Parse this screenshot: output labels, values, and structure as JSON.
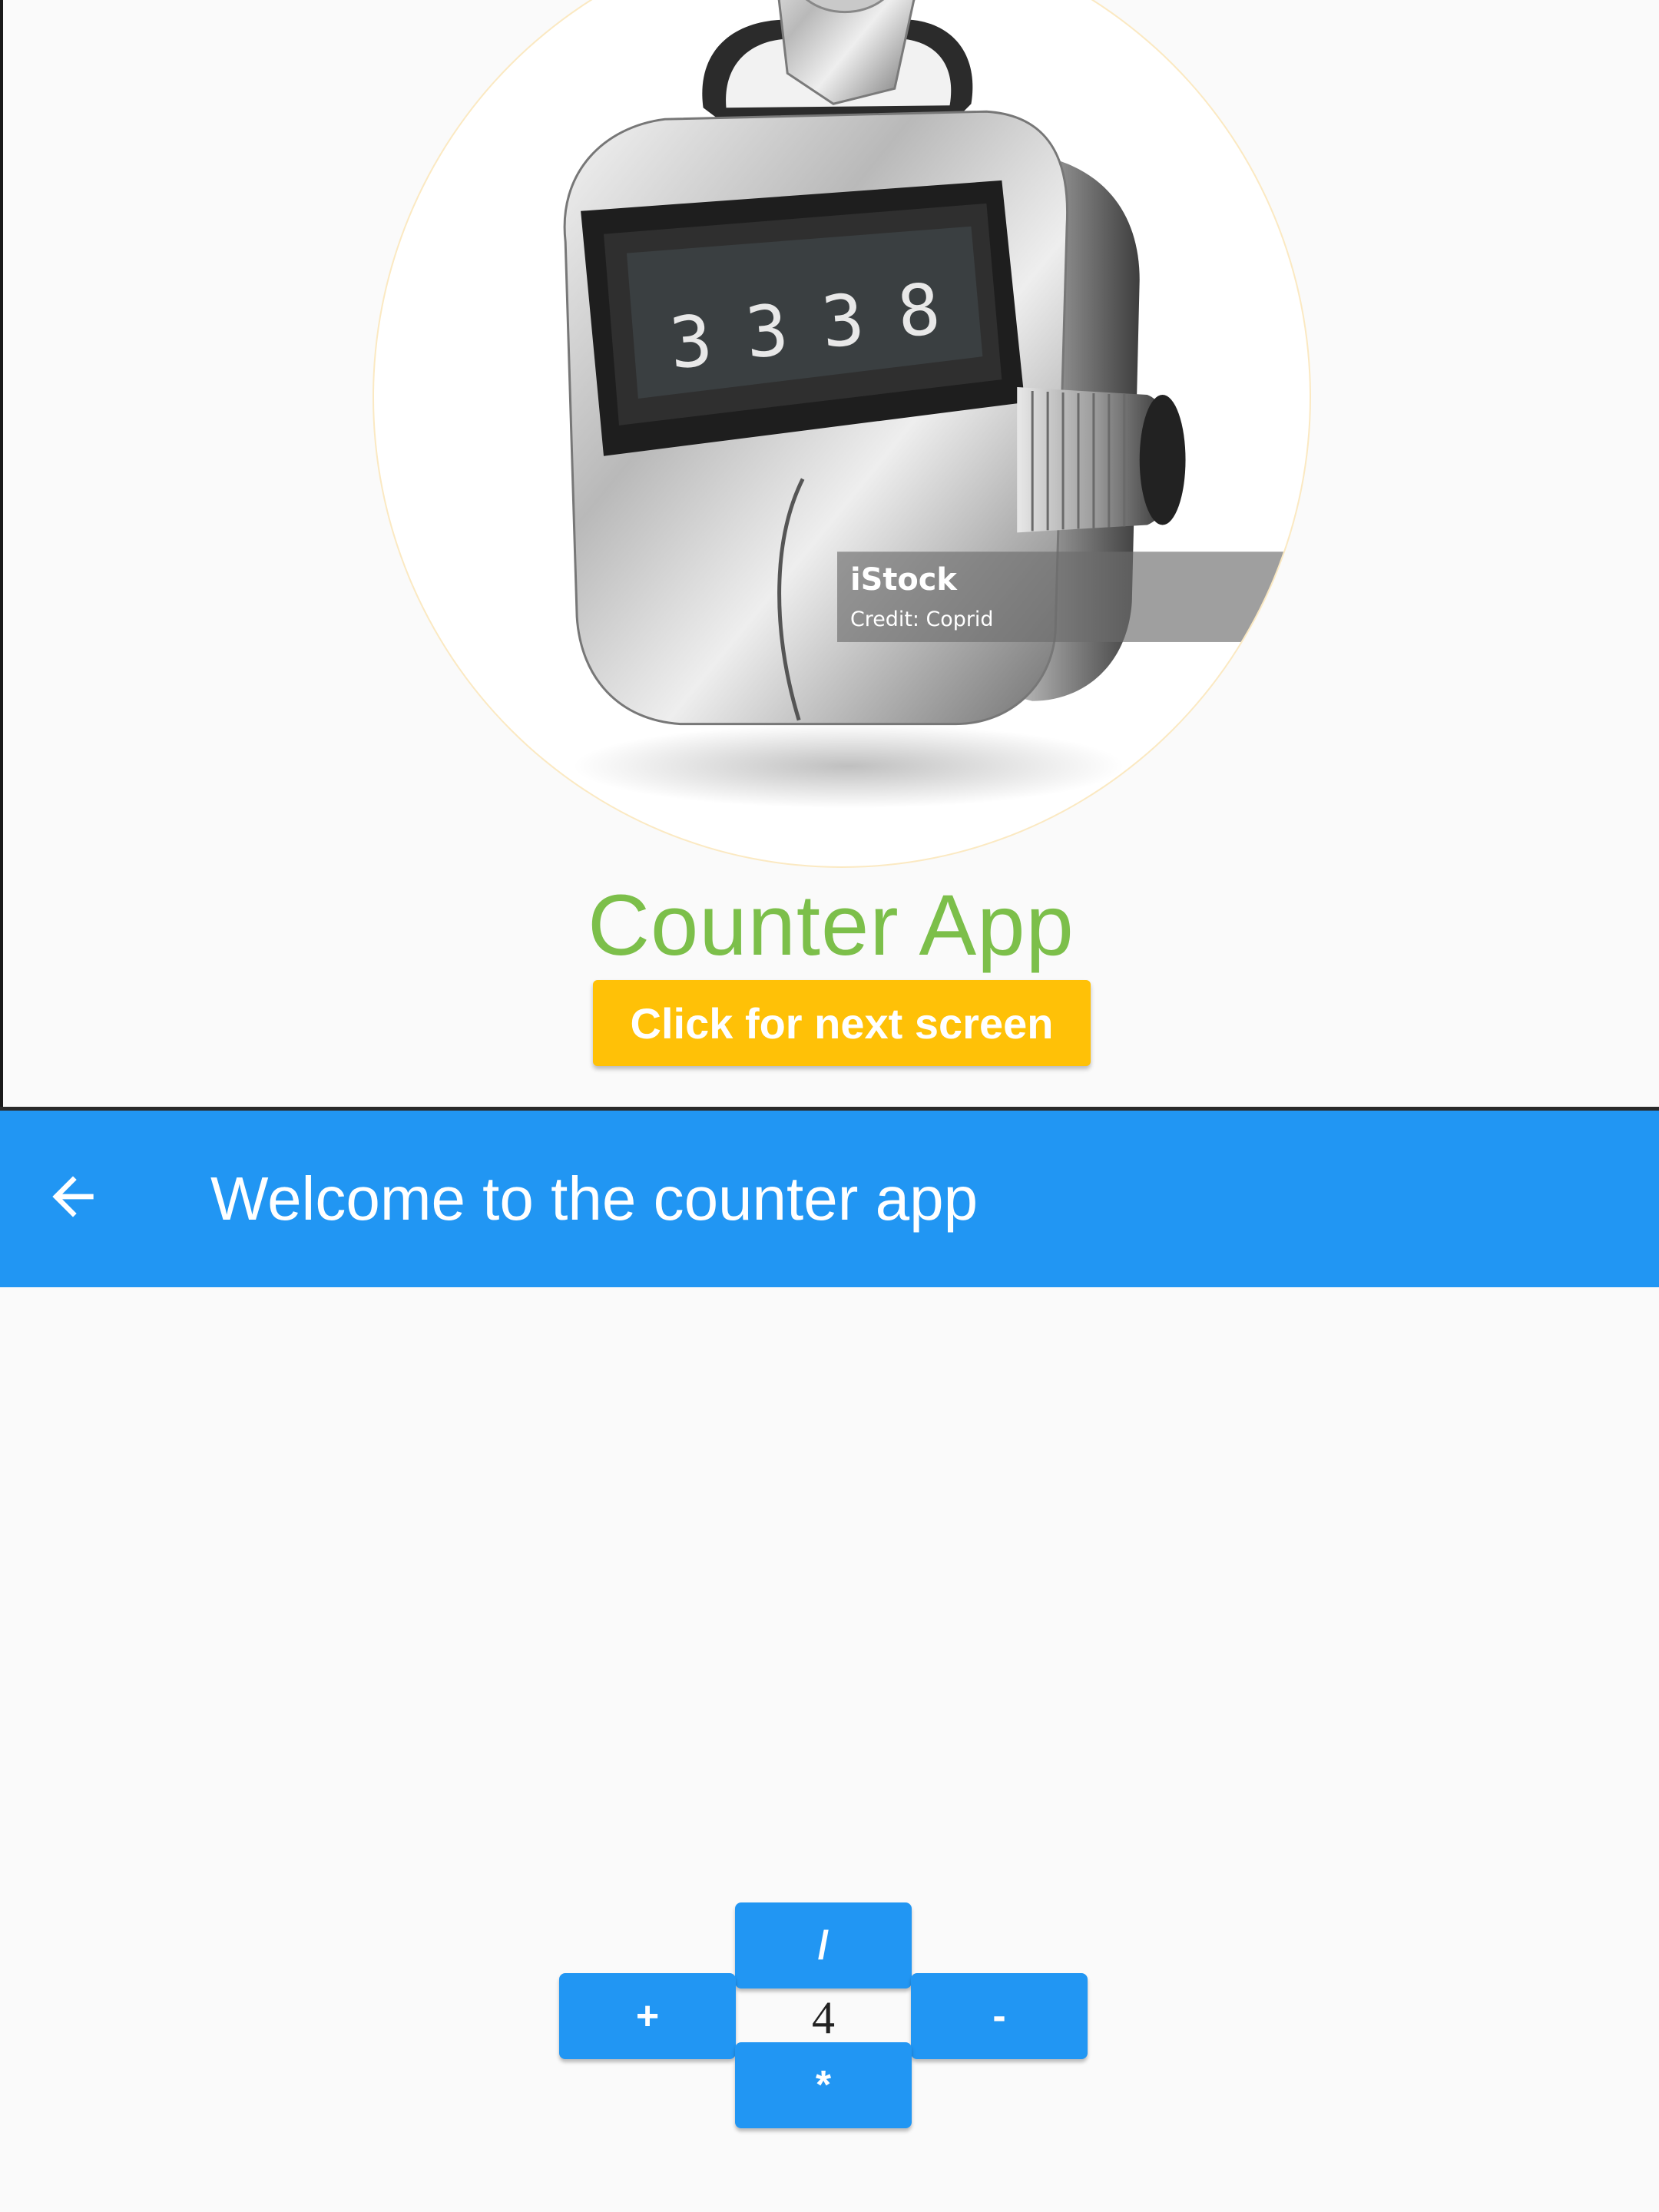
{
  "first_screen": {
    "title": "Counter App",
    "next_button_label": "Click for next screen",
    "image": {
      "counter_digits": [
        "3",
        "3",
        "3",
        "8"
      ],
      "watermark_brand": "iStock",
      "watermark_credit": "Credit: Coprid"
    }
  },
  "second_screen": {
    "app_bar": {
      "title": "Welcome to the counter app",
      "back_icon": "arrow-back-icon"
    },
    "counter": {
      "value": "4",
      "buttons": {
        "divide": "/",
        "add": "+",
        "subtract": "-",
        "multiply": "*"
      }
    }
  },
  "colors": {
    "app_bar": "#2196f3",
    "buttons": "#2196f3",
    "next_button": "#ffc107",
    "title_green": "#7cbf4a",
    "background": "#fafafa"
  }
}
